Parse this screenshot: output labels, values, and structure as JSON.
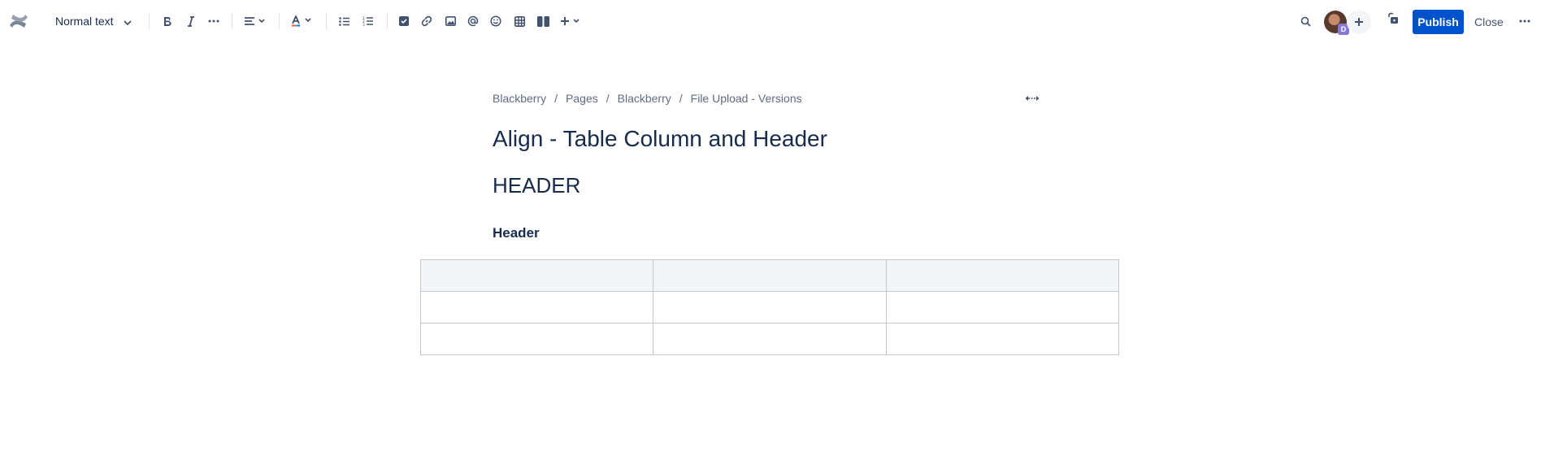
{
  "toolbar": {
    "text_style": "Normal text",
    "publish_label": "Publish",
    "close_label": "Close",
    "avatar_badge": "D",
    "icons": [
      "confluence-logo-icon",
      "bold-icon",
      "italic-icon",
      "more-formatting-icon",
      "align-icon",
      "text-color-icon",
      "bullet-list-icon",
      "numbered-list-icon",
      "action-item-icon",
      "link-icon",
      "image-icon",
      "mention-icon",
      "emoji-icon",
      "table-icon",
      "layouts-icon",
      "insert-icon",
      "search-icon",
      "invite-icon",
      "restrictions-icon",
      "more-icon"
    ]
  },
  "breadcrumb": [
    "Blackberry",
    "Pages",
    "Blackberry",
    "File Upload - Versions"
  ],
  "page": {
    "title": "Align - Table Column and Header",
    "heading1": "HEADER",
    "heading3": "Header"
  },
  "table": {
    "rows": [
      [
        "",
        "",
        ""
      ],
      [
        "",
        "",
        ""
      ],
      [
        "",
        "",
        ""
      ]
    ]
  },
  "colors": {
    "primary": "#0052cc",
    "text": "#172b4d",
    "subtle": "#5e6c84",
    "table_header_bg": "#f4f5f7",
    "table_border": "#c1c7d0",
    "text_color_swatch": "#ff5630"
  }
}
